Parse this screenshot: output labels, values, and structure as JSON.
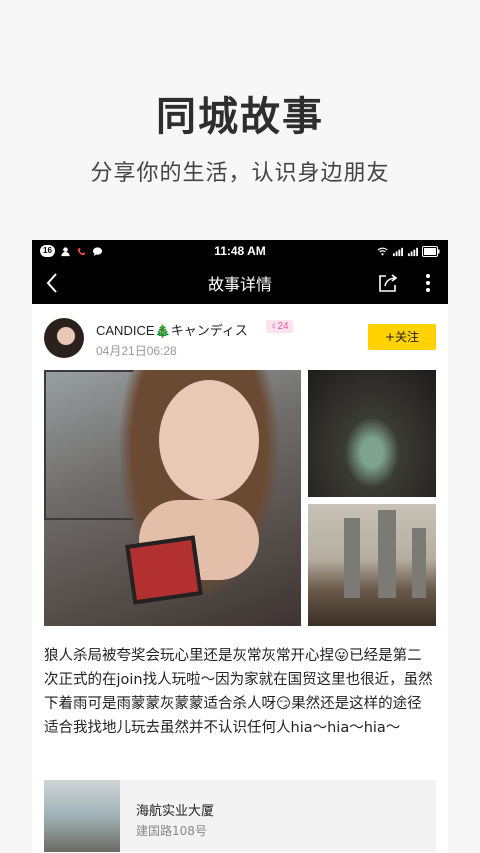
{
  "hero": {
    "title": "同城故事",
    "subtitle": "分享你的生活，认识身边朋友"
  },
  "status_bar": {
    "time": "11:48 AM",
    "notification_badge": "16",
    "icons": [
      "person-icon",
      "missed-call-icon",
      "chat-bubble-icon",
      "wifi-icon",
      "signal-icon",
      "signal-icon",
      "battery-icon"
    ]
  },
  "nav": {
    "title": "故事详情",
    "icons": [
      "back-chevron-icon",
      "share-icon",
      "more-vertical-icon"
    ]
  },
  "post": {
    "username": "CANDICE🎄キャンディス",
    "level": "♀24",
    "datetime": "04月21日06:28",
    "follow_label": "+关注",
    "text": "狼人杀局被夸奖会玩心里还是灰常灰常开心捏😛已经是第二次正式的在join找人玩啦～因为家就在国贸这里也很近，虽然下着雨可是雨蒙蒙灰蒙蒙适合杀人呀😏果然还是这样的途径适合我找地儿玩去虽然并不认识任何人hia～hia～hia～"
  },
  "location": {
    "name": "海航实业大厦",
    "address": "建国路108号"
  },
  "colors": {
    "accent": "#ffd200",
    "level_bg": "#fde3ee",
    "level_text": "#e25a97"
  }
}
